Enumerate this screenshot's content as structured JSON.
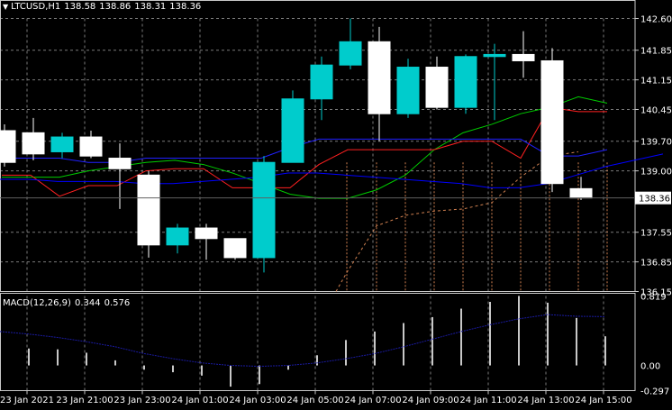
{
  "header": {
    "symbol": "LTCUSD,H1",
    "open": "138.58",
    "high": "138.86",
    "low": "138.31",
    "close": "138.36"
  },
  "macd": {
    "label": "MACD(12,26,9)",
    "main_value": "0.344",
    "signal_value": "0.576",
    "axis_labels": [
      "0.819",
      "0.00",
      "-0.297"
    ],
    "y_ticks": [
      0.819,
      0.0,
      -0.297
    ]
  },
  "price_axis": {
    "labels": [
      "142.60",
      "141.85",
      "141.15",
      "140.45",
      "139.70",
      "139.00",
      "137.55",
      "136.85",
      "136.15"
    ],
    "values": [
      142.6,
      141.85,
      141.15,
      140.45,
      139.7,
      139.0,
      137.55,
      136.85,
      136.15
    ],
    "current_price": "138.36",
    "current_value": 138.36
  },
  "time_axis": {
    "labels": [
      "23 Jan 2021",
      "23 Jan 21:00",
      "23 Jan 23:00",
      "24 Jan 01:00",
      "24 Jan 03:00",
      "24 Jan 05:00",
      "24 Jan 07:00",
      "24 Jan 09:00",
      "24 Jan 11:00",
      "24 Jan 13:00",
      "24 Jan 15:00"
    ]
  },
  "colors": {
    "background": "#000000",
    "grid": "#7a7a7a",
    "bull_candle": "#00cccc",
    "bear_candle": "#ffffff",
    "ma_fast": "#00cc00",
    "ma_mid": "#ff2020",
    "ma_slow": "#2020ff",
    "ma_long": "#0000ff",
    "fib_line": "#d08050",
    "macd_hist": "#c8c8c8",
    "macd_signal": "#1a1aa0"
  },
  "chart_data": {
    "type": "candlestick",
    "symbol": "LTCUSD",
    "timeframe": "H1",
    "candles": [
      {
        "o": 139.95,
        "h": 140.1,
        "l": 139.1,
        "c": 139.2
      },
      {
        "o": 139.9,
        "h": 140.25,
        "l": 139.25,
        "c": 139.4
      },
      {
        "o": 139.45,
        "h": 139.9,
        "l": 139.3,
        "c": 139.8
      },
      {
        "o": 139.8,
        "h": 139.95,
        "l": 139.3,
        "c": 139.35
      },
      {
        "o": 139.3,
        "h": 139.65,
        "l": 138.1,
        "c": 139.05
      },
      {
        "o": 138.9,
        "h": 139.0,
        "l": 136.95,
        "c": 137.25
      },
      {
        "o": 137.25,
        "h": 137.75,
        "l": 137.05,
        "c": 137.65
      },
      {
        "o": 137.65,
        "h": 137.75,
        "l": 136.9,
        "c": 137.4
      },
      {
        "o": 137.4,
        "h": 137.4,
        "l": 136.9,
        "c": 136.95
      },
      {
        "o": 136.95,
        "h": 139.35,
        "l": 136.6,
        "c": 139.2
      },
      {
        "o": 139.2,
        "h": 140.9,
        "l": 139.2,
        "c": 140.7
      },
      {
        "o": 140.7,
        "h": 141.7,
        "l": 140.2,
        "c": 141.5
      },
      {
        "o": 141.5,
        "h": 142.6,
        "l": 141.4,
        "c": 142.05
      },
      {
        "o": 142.05,
        "h": 142.4,
        "l": 139.7,
        "c": 140.35
      },
      {
        "o": 140.35,
        "h": 141.65,
        "l": 140.25,
        "c": 141.45
      },
      {
        "o": 141.45,
        "h": 141.7,
        "l": 140.45,
        "c": 140.5
      },
      {
        "o": 140.5,
        "h": 141.75,
        "l": 140.35,
        "c": 141.7
      },
      {
        "o": 141.7,
        "h": 142.0,
        "l": 140.2,
        "c": 141.75
      },
      {
        "o": 141.75,
        "h": 142.3,
        "l": 141.2,
        "c": 141.6
      },
      {
        "o": 141.6,
        "h": 141.9,
        "l": 138.5,
        "c": 138.7
      },
      {
        "o": 138.58,
        "h": 138.86,
        "l": 138.31,
        "c": 138.36
      }
    ],
    "moving_averages": [
      {
        "color": "#00cc00",
        "values": [
          138.85,
          138.85,
          138.85,
          139.0,
          139.1,
          139.2,
          139.25,
          139.15,
          138.95,
          138.7,
          138.45,
          138.35,
          138.35,
          138.55,
          138.9,
          139.5,
          139.9,
          140.1,
          140.35,
          140.5,
          140.75,
          140.6
        ]
      },
      {
        "color": "#ff2020",
        "values": [
          138.9,
          138.9,
          138.4,
          138.65,
          138.65,
          139.0,
          139.05,
          139.05,
          138.6,
          138.6,
          138.6,
          139.15,
          139.5,
          139.5,
          139.5,
          139.5,
          139.7,
          139.7,
          139.3,
          140.5,
          140.4,
          140.4
        ]
      },
      {
        "color": "#2020ff",
        "values": [
          139.3,
          139.3,
          139.3,
          139.2,
          139.2,
          139.3,
          139.3,
          139.3,
          139.3,
          139.3,
          139.55,
          139.75,
          139.75,
          139.75,
          139.75,
          139.75,
          139.75,
          139.75,
          139.75,
          139.35,
          139.35,
          139.5
        ]
      },
      {
        "color": "#0000ff",
        "values": [
          138.8,
          138.8,
          138.75,
          138.75,
          138.75,
          138.7,
          138.7,
          138.75,
          138.8,
          138.85,
          138.95,
          138.95,
          138.9,
          138.85,
          138.8,
          138.75,
          138.7,
          138.6,
          138.6,
          138.7,
          138.9,
          139.1,
          139.25,
          139.4
        ]
      }
    ],
    "macd_histogram": [
      0.18,
      0.2,
      0.19,
      0.15,
      0.06,
      -0.05,
      -0.08,
      -0.12,
      -0.25,
      -0.22,
      -0.05,
      0.12,
      0.3,
      0.4,
      0.5,
      0.57,
      0.67,
      0.75,
      0.82,
      0.74,
      0.56,
      0.344
    ],
    "macd_signal": [
      0.4,
      0.37,
      0.33,
      0.28,
      0.22,
      0.14,
      0.08,
      0.03,
      0.0,
      -0.01,
      0.0,
      0.03,
      0.08,
      0.14,
      0.22,
      0.31,
      0.4,
      0.48,
      0.55,
      0.6,
      0.58,
      0.576
    ],
    "ylim": [
      136.15,
      142.6
    ],
    "grid": true
  }
}
